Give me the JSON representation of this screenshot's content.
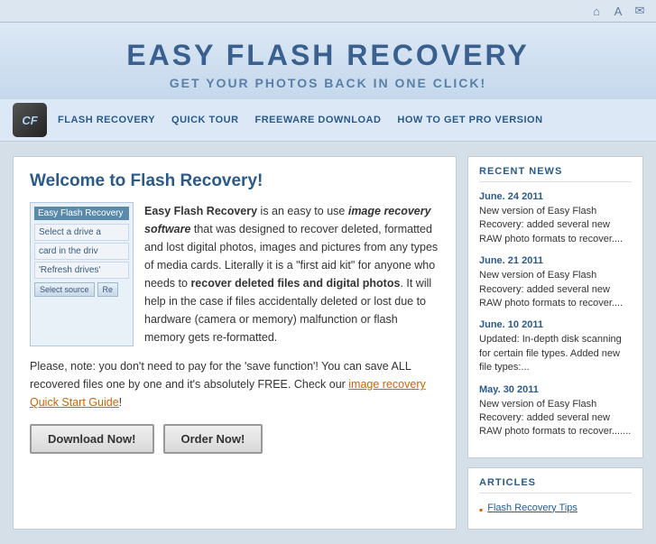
{
  "topbar": {
    "icons": [
      "home-icon",
      "font-icon",
      "email-icon"
    ]
  },
  "header": {
    "title": "EASY FLASH RECOVERY",
    "tagline": "GET YOUR PHOTOS BACK IN ONE CLICK!"
  },
  "logo": {
    "text": "CF"
  },
  "nav": {
    "links": [
      {
        "label": "FLASH RECOVERY",
        "id": "nav-flash-recovery"
      },
      {
        "label": "QUICK TOUR",
        "id": "nav-quick-tour"
      },
      {
        "label": "FREEWARE DOWNLOAD",
        "id": "nav-freeware-download"
      },
      {
        "label": "HOW TO GET PRO VERSION",
        "id": "nav-pro-version"
      }
    ]
  },
  "welcome": {
    "title": "Welcome to Flash Recovery!",
    "screenshot": {
      "app_title": "Easy Flash Recovery",
      "row1": "Select a drive a",
      "row2": "card in the driv",
      "row3": "'Refresh drives'",
      "btn1": "Select source",
      "btn2": "Re"
    },
    "intro_brand": "Easy Flash Recovery",
    "intro_text1": " is an easy to use ",
    "intro_bold1": "image recovery software",
    "intro_text2": " that was designed to recover deleted, formatted and lost digital photos, images and pictures from any types of media cards. Literally it is a \"first aid kit\" for anyone who needs to ",
    "intro_bold2": "recover deleted files and digital photos",
    "intro_text3": ". It will help in the case if files accidentally deleted or lost due to hardware (camera or memory) malfunction or flash memory gets re-formatted.",
    "note_prefix": "Please, note",
    "note_text1": ": you don't need to pay for the ",
    "note_bold1": "'save function'",
    "note_text2": "! You can save ",
    "note_bold2": "ALL",
    "note_text3": " recovered files one by one and it's absolutely ",
    "note_bold3": "FREE",
    "note_text4": ". Check our ",
    "note_link": "image recovery Quick Start Guide",
    "note_text5": "!",
    "btn_download": "Download Now!",
    "btn_order": "Order Now!"
  },
  "sidebar": {
    "recent_news": {
      "title": "RECENT NEWS",
      "items": [
        {
          "date": "June. 24 2011",
          "text": "New version of Easy Flash Recovery: added several new RAW photo formats to recover...."
        },
        {
          "date": "June. 21 2011",
          "text": "New version of Easy Flash Recovery: added several new RAW photo formats to recover...."
        },
        {
          "date": "June. 10 2011",
          "text": "Updated: In-depth disk scanning for certain file types. Added new file types:..."
        },
        {
          "date": "May. 30 2011",
          "text": "New version of Easy Flash Recovery: added several new RAW photo formats to recover......."
        }
      ]
    },
    "articles": {
      "title": "ARTICLES",
      "items": [
        {
          "label": "Flash Recovery Tips"
        }
      ]
    }
  }
}
